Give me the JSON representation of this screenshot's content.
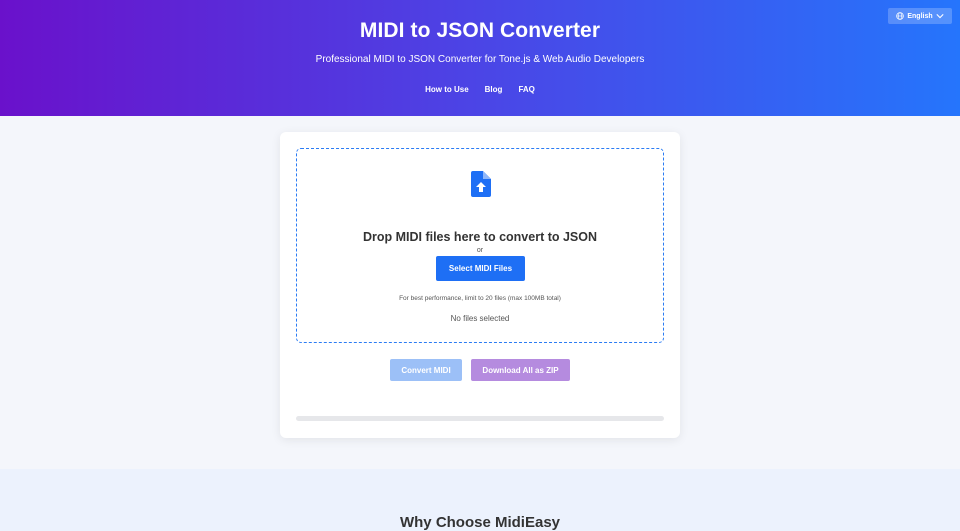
{
  "header": {
    "title": "MIDI to JSON Converter",
    "subtitle": "Professional MIDI to JSON Converter for Tone.js & Web Audio Developers",
    "nav": [
      "How to Use",
      "Blog",
      "FAQ"
    ],
    "language": "English"
  },
  "dropzone": {
    "title": "Drop MIDI files here to convert to JSON",
    "or": "or",
    "select_button": "Select MIDI Files",
    "limit_note": "For best performance, limit to 20 files (max 100MB total)",
    "status": "No files selected",
    "icon": "file-upload-icon"
  },
  "actions": {
    "convert": "Convert MIDI",
    "download_zip": "Download All as ZIP"
  },
  "progress": {
    "value": 0
  },
  "why": {
    "title": "Why Choose MidiEasy"
  },
  "colors": {
    "gradient_start": "#6a11cb",
    "gradient_end": "#2575fc",
    "primary": "#1e6ff5",
    "convert_disabled": "#9cc0f7",
    "zip_disabled": "#b58bdf"
  }
}
